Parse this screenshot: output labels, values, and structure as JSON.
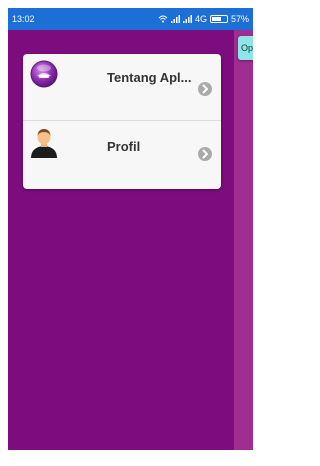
{
  "status_bar": {
    "time": "13:02",
    "icons": [
      "wifi-icon",
      "signal-icon",
      "signal-icon",
      "network-4g-icon",
      "battery-icon"
    ],
    "network_label": "4G",
    "battery_percent": "57%"
  },
  "right_panel": {
    "button_label": "Op"
  },
  "menu": {
    "items": [
      {
        "label": "Tentang Apl...",
        "icon": "app-info-icon"
      },
      {
        "label": "Profil",
        "icon": "person-avatar-icon"
      }
    ]
  },
  "colors": {
    "background": "#7d0d7e",
    "status_bar": "#1b6fd6",
    "right_panel": "#a02d90",
    "card": "#f7f7f7"
  }
}
